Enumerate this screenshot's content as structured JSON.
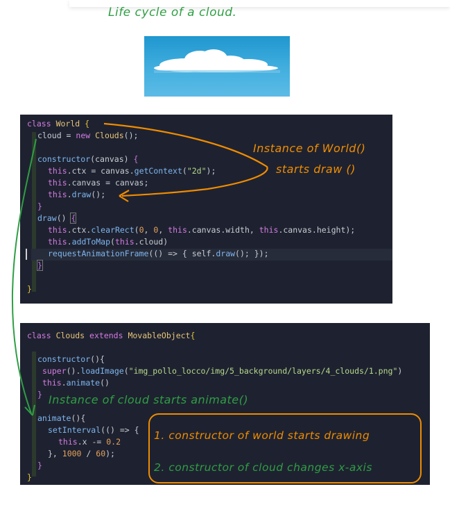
{
  "title": "Life cycle of a cloud.",
  "colors": {
    "green": "#2f9e44",
    "orange": "#f08c00",
    "code_bg": "#1e2230",
    "sky": "#3aa8dc"
  },
  "code1": {
    "l1_kw": "class",
    "l1_cls": "World",
    "l1_br": "{",
    "l2_pre": "cloud = ",
    "l2_new": "new",
    "l2_cls": "Clouds",
    "l2_end": "();",
    "l4_fn": "constructor",
    "l4_args": "(canvas) ",
    "l4_br": "{",
    "l5_this": "this",
    "l5_a": ".ctx = canvas.",
    "l5_fn": "getContext",
    "l5_p1": "(",
    "l5_str": "\"2d\"",
    "l5_p2": ");",
    "l6_this": "this",
    "l6_a": ".canvas = canvas;",
    "l7_this": "this",
    "l7_a": ".",
    "l7_fn": "draw",
    "l7_b": "();",
    "l8": "}",
    "l9_fn": "draw",
    "l9_args": "() ",
    "l9_br": "{",
    "l10_this": "this",
    "l10_a": ".ctx.",
    "l10_fn": "clearRect",
    "l10_b": "(",
    "l10_n1": "0",
    "l10_c": ", ",
    "l10_n2": "0",
    "l10_d": ", ",
    "l10_this2": "this",
    "l10_e": ".canvas.width, ",
    "l10_this3": "this",
    "l10_f": ".canvas.height);",
    "l11_this": "this",
    "l11_a": ".",
    "l11_fn": "addToMap",
    "l11_b": "(",
    "l11_this2": "this",
    "l11_c": ".cloud)",
    "l12_fn": "requestAnimationFrame",
    "l12_a": "(() => { self.",
    "l12_fn2": "draw",
    "l12_b": "(); });",
    "l13": "}",
    "l15": "}"
  },
  "code2": {
    "l1_kw": "class",
    "l1_cls": "Clouds",
    "l1_kw2": "extends",
    "l1_cls2": "MovableObject",
    "l1_br": "{",
    "l3_fn": "constructor",
    "l3_a": "(){",
    "l4_kw": "super",
    "l4_a": "().",
    "l4_fn": "loadImage",
    "l4_b": "(",
    "l4_str": "\"img_pollo_locco/img/5_background/layers/4_clouds/1.png\"",
    "l4_c": ")",
    "l5_this": "this",
    "l5_a": ".",
    "l5_fn": "animate",
    "l5_b": "()",
    "l6": "}",
    "l7_fn": "animate",
    "l7_a": "(){",
    "l8_fn": "setInterval",
    "l8_a": "(() => {",
    "l9_this": "this",
    "l9_a": ".x -= ",
    "l9_num": "0.2",
    "l10_a": "}, ",
    "l10_n1": "1000",
    "l10_b": " / ",
    "l10_n2": "60",
    "l10_c": ");",
    "l11": "}",
    "l12": "}"
  },
  "annotations": {
    "instance_world": "Instance of World()",
    "starts_draw": "starts draw ()",
    "instance_cloud": "Instance of cloud starts animate()",
    "note1": "1. constructor of world starts drawing",
    "note2": "2. constructor of cloud changes x-axis"
  }
}
